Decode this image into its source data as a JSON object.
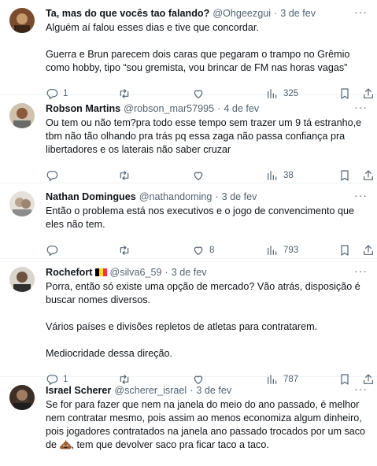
{
  "tweets": [
    {
      "name": "Ta, mas do que vocês tao falando?",
      "handle": "@Ohgeezgui",
      "time": "3 de fev",
      "text": "Alguém aí falou esses dias e tive que concordar.\n\nGuerra e Brun parecem dois caras que pegaram o trampo no Grêmio como hobby, tipo “sou gremista, vou brincar de FM nas horas vagas”",
      "replies": "1",
      "retweets": "",
      "likes": "",
      "views": "325"
    },
    {
      "name": "Robson Martins",
      "handle": "@robson_mar57995",
      "time": "4 de fev",
      "text": "Ou tem ou não tem?pra todo esse tempo sem trazer um 9 tá estranho,e tbm não tão olhando pra trás pq essa zaga não passa confiança pra libertadores e os laterais não saber cruzar",
      "replies": "",
      "retweets": "",
      "likes": "",
      "views": "38"
    },
    {
      "name": "Nathan Domingues",
      "handle": "@nathandoming",
      "time": "3 de fev",
      "text": "Então o problema está nos executivos e o jogo de convencimento que eles não tem.",
      "replies": "",
      "retweets": "",
      "likes": "8",
      "views": "793"
    },
    {
      "name": "Rochefort",
      "handle": "@silva6_59",
      "time": "3 de fev",
      "text": "Porra, então só existe uma opção de mercado? Vão atrás, disposição é buscar nomes diversos.\n\nVários países e divisões repletos de atletas para contratarem.\n\nMediocridade dessa direção.",
      "replies": "1",
      "retweets": "",
      "likes": "",
      "views": "787"
    },
    {
      "name": "Israel Scherer",
      "handle": "@scherer_israel",
      "time": "3 de fev",
      "text": "Se for para fazer que nem na janela do meio do ano passado, é melhor nem contratar mesmo, pois assim ao menos economiza algum dinheiro, pois jogadores contratados na janela ano passado trocados por um saco de",
      "text_tail": ", tem que devolver saco pra ficar taco a taco.",
      "replies": "",
      "retweets": "",
      "likes": "",
      "views": ""
    }
  ],
  "colors": {
    "text": "#0f1419",
    "muted": "#536471",
    "divider": "#eff3f4",
    "flag_black": "#000000",
    "flag_yellow": "#fdda24",
    "flag_red": "#ef3340"
  },
  "icons": {
    "more": "more-icon",
    "reply": "reply-icon",
    "retweet": "retweet-icon",
    "like": "heart-icon",
    "views": "views-icon",
    "bookmark": "bookmark-icon",
    "share": "share-icon",
    "emoji": "pile-of-poo-emoji"
  }
}
